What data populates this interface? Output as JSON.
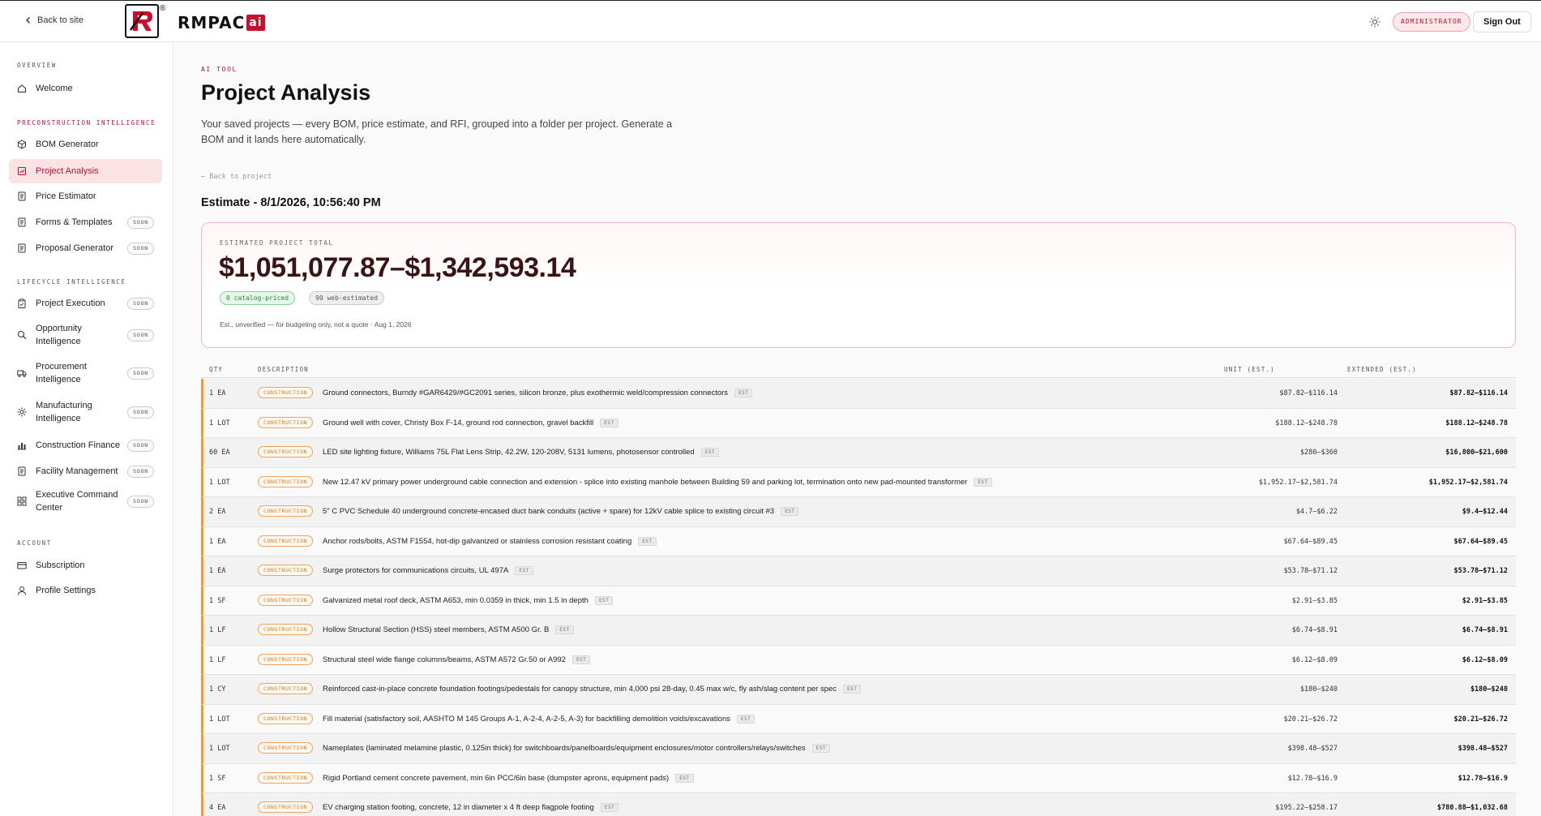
{
  "header": {
    "back_label": "Back to site",
    "logo_text": "RMPAC",
    "logo_ai": "ai",
    "logo_reg": "®",
    "role_badge": "ADMINISTRATOR",
    "signout_label": "Sign Out"
  },
  "sidebar": {
    "sections": {
      "overview": "OVERVIEW",
      "precon": "PRECONSTRUCTION INTELLIGENCE",
      "lifecycle": "LIFECYCLE INTELLIGENCE",
      "account": "ACCOUNT"
    },
    "soon_label": "SOON",
    "items": {
      "welcome": "Welcome",
      "bom": "BOM Generator",
      "analysis": "Project Analysis",
      "price": "Price Estimator",
      "forms": "Forms & Templates",
      "proposal": "Proposal Generator",
      "execution": "Project Execution",
      "opportunity_1": "Opportunity",
      "opportunity_2": "Intelligence",
      "procurement_1": "Procurement",
      "procurement_2": "Intelligence",
      "manufacturing_1": "Manufacturing",
      "manufacturing_2": "Intelligence",
      "finance": "Construction Finance",
      "facility": "Facility Management",
      "executive_1": "Executive Command",
      "executive_2": "Center",
      "subscription": "Subscription",
      "profile": "Profile Settings"
    }
  },
  "main": {
    "eyebrow": "AI TOOL",
    "title": "Project Analysis",
    "description": "Your saved projects — every BOM, price estimate, and RFI, grouped into a folder per project. Generate a BOM and it lands here automatically.",
    "back_project": "← Back to project",
    "estimate_title": "Estimate - 8/1/2026, 10:56:40 PM",
    "total": {
      "label": "ESTIMATED PROJECT TOTAL",
      "value": "$1,051,077.87–$1,342,593.14",
      "catalog_pill": "0 catalog-priced",
      "web_pill": "90 web-estimated",
      "note": "Est., unverified — for budgeting only, not a quote · Aug 1, 2026"
    },
    "table": {
      "headers": {
        "qty": "QTY",
        "description": "DESCRIPTION",
        "unit": "UNIT (EST.)",
        "extended": "EXTENDED (EST.)"
      },
      "tag_label": "CONSTRUCTION",
      "est_label": "EST",
      "rows": [
        {
          "qty": "1 EA",
          "desc": "Ground connectors, Burndy #GAR6429/#GC2091 series, silicon bronze, plus exothermic weld/compression connectors",
          "unit": "$87.82–$116.14",
          "ext": "$87.82–$116.14"
        },
        {
          "qty": "1 LOT",
          "desc": "Ground well with cover, Christy Box F-14, ground rod connection, gravel backfill",
          "unit": "$188.12–$248.78",
          "ext": "$188.12–$248.78"
        },
        {
          "qty": "60 EA",
          "desc": "LED site lighting fixture, Williams 75L Flat Lens Strip, 42.2W, 120-208V, 5131 lumens, photosensor controlled",
          "unit": "$280–$360",
          "ext": "$16,800–$21,600"
        },
        {
          "qty": "1 LOT",
          "desc": "New 12.47 kV primary power underground cable connection and extension - splice into existing manhole between Building 59 and parking lot, termination onto new pad-mounted transformer",
          "unit": "$1,952.17–$2,581.74",
          "ext": "$1,952.17–$2,581.74"
        },
        {
          "qty": "2 EA",
          "desc": "5\" C PVC Schedule 40 underground concrete-encased duct bank conduits (active + spare) for 12kV cable splice to existing circuit #3",
          "unit": "$4.7–$6.22",
          "ext": "$9.4–$12.44"
        },
        {
          "qty": "1 EA",
          "desc": "Anchor rods/bolts, ASTM F1554, hot-dip galvanized or stainless corrosion resistant coating",
          "unit": "$67.64–$89.45",
          "ext": "$67.64–$89.45"
        },
        {
          "qty": "1 EA",
          "desc": "Surge protectors for communications circuits, UL 497A",
          "unit": "$53.78–$71.12",
          "ext": "$53.78–$71.12"
        },
        {
          "qty": "1 SF",
          "desc": "Galvanized metal roof deck, ASTM A653, min 0.0359 in thick, min 1.5 in depth",
          "unit": "$2.91–$3.85",
          "ext": "$2.91–$3.85"
        },
        {
          "qty": "1 LF",
          "desc": "Hollow Structural Section (HSS) steel members, ASTM A500 Gr. B",
          "unit": "$6.74–$8.91",
          "ext": "$6.74–$8.91"
        },
        {
          "qty": "1 LF",
          "desc": "Structural steel wide flange columns/beams, ASTM A572 Gr.50 or A992",
          "unit": "$6.12–$8.09",
          "ext": "$6.12–$8.09"
        },
        {
          "qty": "1 CY",
          "desc": "Reinforced cast-in-place concrete foundation footings/pedestals for canopy structure, min 4,000 psi 28-day, 0.45 max w/c, fly ash/slag content per spec",
          "unit": "$180–$240",
          "ext": "$180–$240"
        },
        {
          "qty": "1 LOT",
          "desc": "Fill material (satisfactory soil, AASHTO M 145 Groups A-1, A-2-4, A-2-5, A-3) for backfilling demolition voids/excavations",
          "unit": "$20.21–$26.72",
          "ext": "$20.21–$26.72"
        },
        {
          "qty": "1 LOT",
          "desc": "Nameplates (laminated melamine plastic, 0.125in thick) for switchboards/panelboards/equipment enclosures/motor controllers/relays/switches",
          "unit": "$398.48–$527",
          "ext": "$398.48–$527"
        },
        {
          "qty": "1 SF",
          "desc": "Rigid Portland cement concrete pavement, min 6in PCC/6in base (dumpster aprons, equipment pads)",
          "unit": "$12.78–$16.9",
          "ext": "$12.78–$16.9"
        },
        {
          "qty": "4 EA",
          "desc": "EV charging station footing, concrete, 12 in diameter x 4 ft deep flagpole footing",
          "unit": "$195.22–$258.17",
          "ext": "$780.88–$1,032.68"
        }
      ]
    }
  },
  "colors": {
    "accent": "#c8102e",
    "row_marker": "#f39c2b",
    "active_bg": "#fbe3e5"
  }
}
